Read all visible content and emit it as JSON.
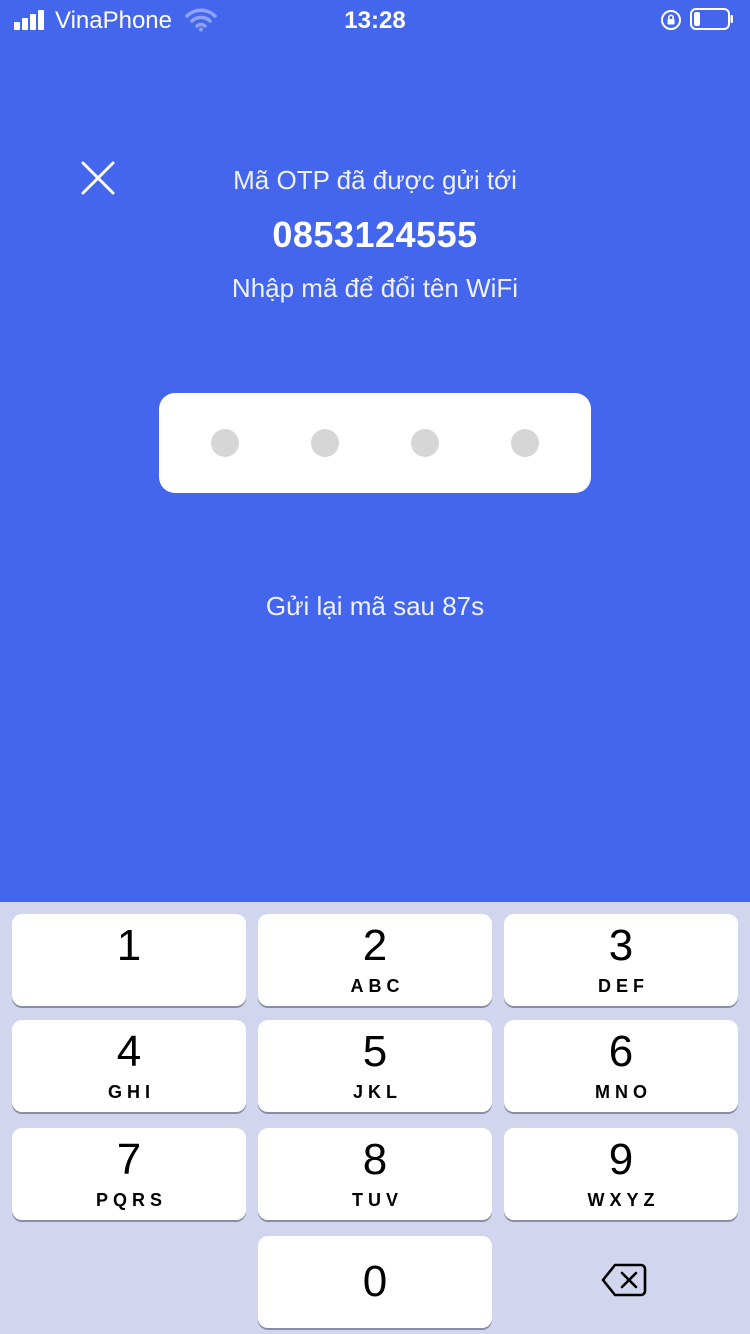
{
  "status_bar": {
    "carrier": "VinaPhone",
    "time": "13:28",
    "icons": [
      "signal-icon",
      "wifi-icon",
      "rotation-lock-icon",
      "battery-icon"
    ]
  },
  "header": {
    "close_icon": "close-icon",
    "sent_label": "Mã OTP đã được gửi tới",
    "phone_number": "0853124555",
    "instruction": "Nhập mã để đổi tên WiFi"
  },
  "otp": {
    "digits_entered": 0,
    "digits_total": 4
  },
  "resend_text": "Gửi lại mã sau 87s",
  "keypad": {
    "keys": [
      {
        "digit": "1",
        "letters": ""
      },
      {
        "digit": "2",
        "letters": "ABC"
      },
      {
        "digit": "3",
        "letters": "DEF"
      },
      {
        "digit": "4",
        "letters": "GHI"
      },
      {
        "digit": "5",
        "letters": "JKL"
      },
      {
        "digit": "6",
        "letters": "MNO"
      },
      {
        "digit": "7",
        "letters": "PQRS"
      },
      {
        "digit": "8",
        "letters": "TUV"
      },
      {
        "digit": "9",
        "letters": "WXYZ"
      },
      {
        "digit": "0",
        "letters": ""
      }
    ],
    "backspace_icon": "backspace-icon"
  },
  "colors": {
    "background": "#4466ED",
    "keypad_background": "#D1D5ED",
    "key": "#FFFFFF",
    "otp_dot": "#D6D6D6"
  }
}
